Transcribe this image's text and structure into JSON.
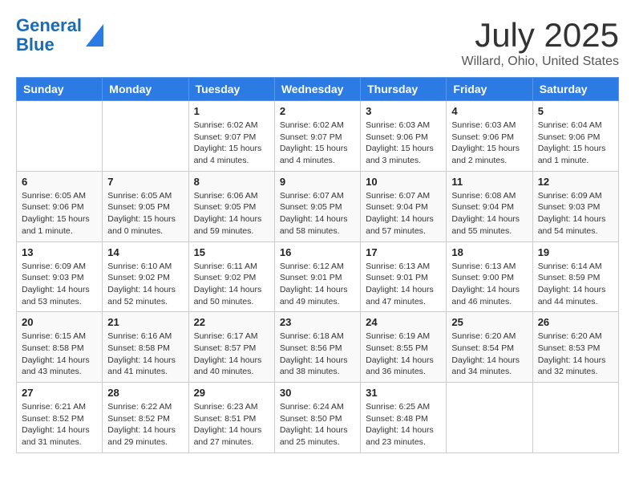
{
  "header": {
    "logo_line1": "General",
    "logo_line2": "Blue",
    "month_title": "July 2025",
    "location": "Willard, Ohio, United States"
  },
  "days_of_week": [
    "Sunday",
    "Monday",
    "Tuesday",
    "Wednesday",
    "Thursday",
    "Friday",
    "Saturday"
  ],
  "weeks": [
    [
      {
        "day": "",
        "info": ""
      },
      {
        "day": "",
        "info": ""
      },
      {
        "day": "1",
        "info": "Sunrise: 6:02 AM\nSunset: 9:07 PM\nDaylight: 15 hours\nand 4 minutes."
      },
      {
        "day": "2",
        "info": "Sunrise: 6:02 AM\nSunset: 9:07 PM\nDaylight: 15 hours\nand 4 minutes."
      },
      {
        "day": "3",
        "info": "Sunrise: 6:03 AM\nSunset: 9:06 PM\nDaylight: 15 hours\nand 3 minutes."
      },
      {
        "day": "4",
        "info": "Sunrise: 6:03 AM\nSunset: 9:06 PM\nDaylight: 15 hours\nand 2 minutes."
      },
      {
        "day": "5",
        "info": "Sunrise: 6:04 AM\nSunset: 9:06 PM\nDaylight: 15 hours\nand 1 minute."
      }
    ],
    [
      {
        "day": "6",
        "info": "Sunrise: 6:05 AM\nSunset: 9:06 PM\nDaylight: 15 hours\nand 1 minute."
      },
      {
        "day": "7",
        "info": "Sunrise: 6:05 AM\nSunset: 9:05 PM\nDaylight: 15 hours\nand 0 minutes."
      },
      {
        "day": "8",
        "info": "Sunrise: 6:06 AM\nSunset: 9:05 PM\nDaylight: 14 hours\nand 59 minutes."
      },
      {
        "day": "9",
        "info": "Sunrise: 6:07 AM\nSunset: 9:05 PM\nDaylight: 14 hours\nand 58 minutes."
      },
      {
        "day": "10",
        "info": "Sunrise: 6:07 AM\nSunset: 9:04 PM\nDaylight: 14 hours\nand 57 minutes."
      },
      {
        "day": "11",
        "info": "Sunrise: 6:08 AM\nSunset: 9:04 PM\nDaylight: 14 hours\nand 55 minutes."
      },
      {
        "day": "12",
        "info": "Sunrise: 6:09 AM\nSunset: 9:03 PM\nDaylight: 14 hours\nand 54 minutes."
      }
    ],
    [
      {
        "day": "13",
        "info": "Sunrise: 6:09 AM\nSunset: 9:03 PM\nDaylight: 14 hours\nand 53 minutes."
      },
      {
        "day": "14",
        "info": "Sunrise: 6:10 AM\nSunset: 9:02 PM\nDaylight: 14 hours\nand 52 minutes."
      },
      {
        "day": "15",
        "info": "Sunrise: 6:11 AM\nSunset: 9:02 PM\nDaylight: 14 hours\nand 50 minutes."
      },
      {
        "day": "16",
        "info": "Sunrise: 6:12 AM\nSunset: 9:01 PM\nDaylight: 14 hours\nand 49 minutes."
      },
      {
        "day": "17",
        "info": "Sunrise: 6:13 AM\nSunset: 9:01 PM\nDaylight: 14 hours\nand 47 minutes."
      },
      {
        "day": "18",
        "info": "Sunrise: 6:13 AM\nSunset: 9:00 PM\nDaylight: 14 hours\nand 46 minutes."
      },
      {
        "day": "19",
        "info": "Sunrise: 6:14 AM\nSunset: 8:59 PM\nDaylight: 14 hours\nand 44 minutes."
      }
    ],
    [
      {
        "day": "20",
        "info": "Sunrise: 6:15 AM\nSunset: 8:58 PM\nDaylight: 14 hours\nand 43 minutes."
      },
      {
        "day": "21",
        "info": "Sunrise: 6:16 AM\nSunset: 8:58 PM\nDaylight: 14 hours\nand 41 minutes."
      },
      {
        "day": "22",
        "info": "Sunrise: 6:17 AM\nSunset: 8:57 PM\nDaylight: 14 hours\nand 40 minutes."
      },
      {
        "day": "23",
        "info": "Sunrise: 6:18 AM\nSunset: 8:56 PM\nDaylight: 14 hours\nand 38 minutes."
      },
      {
        "day": "24",
        "info": "Sunrise: 6:19 AM\nSunset: 8:55 PM\nDaylight: 14 hours\nand 36 minutes."
      },
      {
        "day": "25",
        "info": "Sunrise: 6:20 AM\nSunset: 8:54 PM\nDaylight: 14 hours\nand 34 minutes."
      },
      {
        "day": "26",
        "info": "Sunrise: 6:20 AM\nSunset: 8:53 PM\nDaylight: 14 hours\nand 32 minutes."
      }
    ],
    [
      {
        "day": "27",
        "info": "Sunrise: 6:21 AM\nSunset: 8:52 PM\nDaylight: 14 hours\nand 31 minutes."
      },
      {
        "day": "28",
        "info": "Sunrise: 6:22 AM\nSunset: 8:52 PM\nDaylight: 14 hours\nand 29 minutes."
      },
      {
        "day": "29",
        "info": "Sunrise: 6:23 AM\nSunset: 8:51 PM\nDaylight: 14 hours\nand 27 minutes."
      },
      {
        "day": "30",
        "info": "Sunrise: 6:24 AM\nSunset: 8:50 PM\nDaylight: 14 hours\nand 25 minutes."
      },
      {
        "day": "31",
        "info": "Sunrise: 6:25 AM\nSunset: 8:48 PM\nDaylight: 14 hours\nand 23 minutes."
      },
      {
        "day": "",
        "info": ""
      },
      {
        "day": "",
        "info": ""
      }
    ]
  ]
}
